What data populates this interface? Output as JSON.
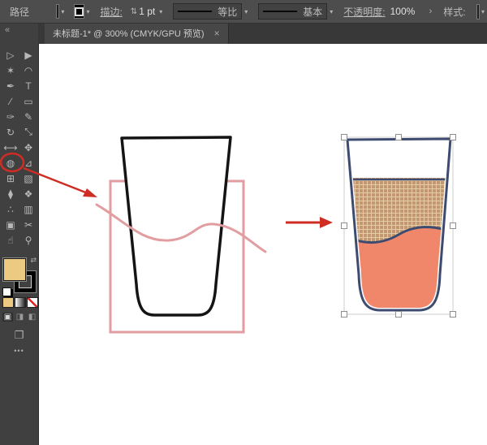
{
  "control_bar": {
    "selection_label": "路径",
    "stroke_label": "描边:",
    "stroke_value": "1 pt",
    "profile_label": "等比",
    "brush_label": "基本",
    "opacity_label": "不透明度:",
    "opacity_value": "100%",
    "opacity_expand": "›",
    "style_label": "样式:"
  },
  "glyphs": {
    "chevron": "▾",
    "stepper": "⇅",
    "swap": "⇄",
    "screen_mode": "❐"
  },
  "tab": {
    "title": "未标题-1* @ 300% (CMYK/GPU 预览)",
    "close": "×"
  },
  "toolbar": {
    "collapse_label": "«",
    "more_label": "•••",
    "tools": [
      {
        "name": "selection",
        "glyph": "▷"
      },
      {
        "name": "direct-selection",
        "glyph": "▶"
      },
      {
        "name": "magic-wand",
        "glyph": "✶"
      },
      {
        "name": "lasso",
        "glyph": "◠"
      },
      {
        "name": "pen",
        "glyph": "✒"
      },
      {
        "name": "type",
        "glyph": "T"
      },
      {
        "name": "line-segment",
        "glyph": "∕"
      },
      {
        "name": "rectangle",
        "glyph": "▭"
      },
      {
        "name": "paintbrush",
        "glyph": "✑"
      },
      {
        "name": "pencil",
        "glyph": "✎"
      },
      {
        "name": "rotate",
        "glyph": "↻"
      },
      {
        "name": "scale",
        "glyph": "⤡"
      },
      {
        "name": "width",
        "glyph": "⟷"
      },
      {
        "name": "free-transform",
        "glyph": "✥"
      },
      {
        "name": "shape-builder",
        "glyph": "◍"
      },
      {
        "name": "perspective-grid",
        "glyph": "⊿"
      },
      {
        "name": "mesh",
        "glyph": "⊞"
      },
      {
        "name": "gradient",
        "glyph": "▧"
      },
      {
        "name": "eyedropper",
        "glyph": "⧫"
      },
      {
        "name": "blend",
        "glyph": "❖"
      },
      {
        "name": "symbol-sprayer",
        "glyph": "∴"
      },
      {
        "name": "column-graph",
        "glyph": "▥"
      },
      {
        "name": "artboard",
        "glyph": "▣"
      },
      {
        "name": "slice",
        "glyph": "✂"
      },
      {
        "name": "hand",
        "glyph": "☝"
      },
      {
        "name": "zoom",
        "glyph": "⚲"
      }
    ],
    "modes": [
      {
        "name": "draw-normal",
        "glyph": "▣"
      },
      {
        "name": "draw-behind",
        "glyph": "◨"
      },
      {
        "name": "draw-inside",
        "glyph": "◧"
      }
    ]
  },
  "colors": {
    "fill_swatch": "#ecca81",
    "stroke_swatch": "#000000",
    "style_swatch": "#e9e9e9",
    "sketch_stroke": "#141414",
    "annotation_pink": "#e29da1",
    "annotation_red": "#cf2d24",
    "result_outline": "#3e4b70",
    "liquid_top": "#c39770",
    "liquid_top_grid": "#e5cba6",
    "liquid_bottom": "#f0876a",
    "handle_border": "#8f8f8f"
  }
}
